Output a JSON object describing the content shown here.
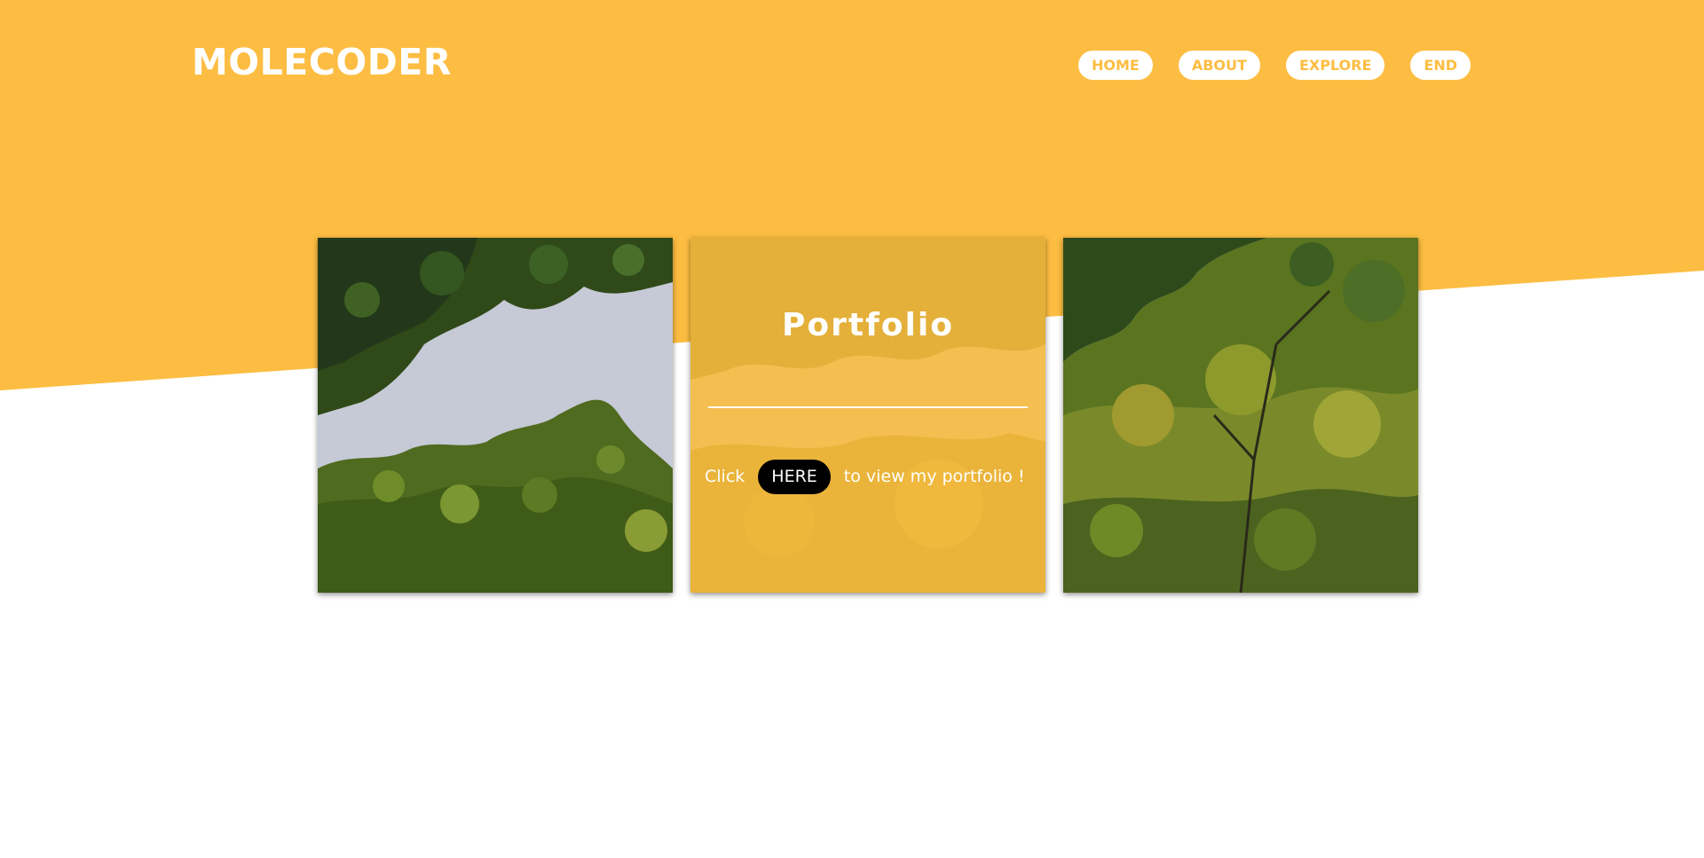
{
  "brand": {
    "logo_text": "MOLECODER"
  },
  "nav": {
    "items": [
      {
        "label": "HOME"
      },
      {
        "label": "ABOUT"
      },
      {
        "label": "EXPLORE"
      },
      {
        "label": "END"
      }
    ]
  },
  "portfolio_card": {
    "title": "Portfolio",
    "text_before": "Click",
    "button_label": "HERE",
    "text_after": "to view my portfolio !"
  },
  "colors": {
    "accent": "#fdbd42",
    "background": "#ffffff",
    "button_dark": "#000000"
  }
}
